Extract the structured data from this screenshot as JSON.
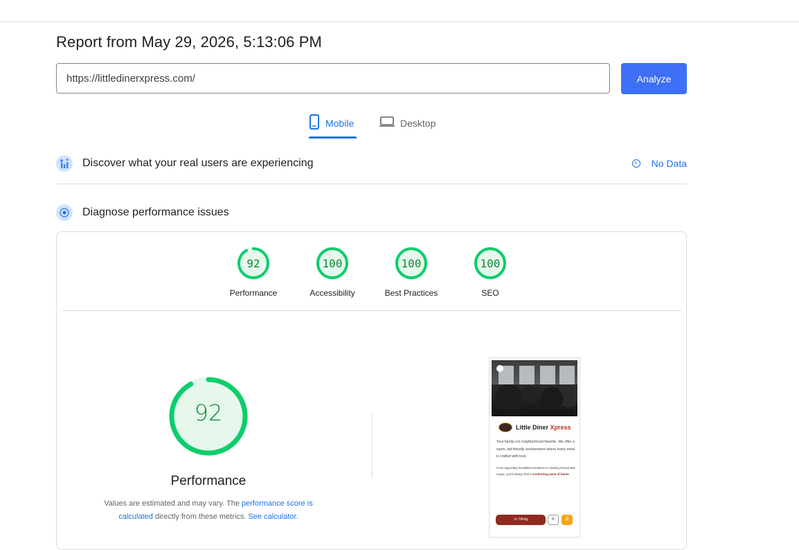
{
  "colors": {
    "primary": "#3e6ff4",
    "link": "#1a73e8",
    "score_good": "#0cce6b",
    "score_text": "#0a8a35",
    "divider": "#dadce0"
  },
  "report": {
    "title": "Report from May 29, 2026, 5:13:06 PM"
  },
  "url_input": {
    "value": "https://littledinerxpress.com/"
  },
  "analyze_button": {
    "label": "Analyze"
  },
  "tabs": [
    {
      "label": "Mobile",
      "icon": "smartphone-icon",
      "selected": true
    },
    {
      "label": "Desktop",
      "icon": "laptop-icon",
      "selected": false
    }
  ],
  "crux": {
    "title": "Discover what your real users are experiencing",
    "icon": "users-chart-icon",
    "status_label": "No Data",
    "status_icon": "info-icon"
  },
  "diagnose": {
    "title": "Diagnose performance issues",
    "icon": "target-icon"
  },
  "scores": [
    {
      "label": "Performance",
      "value": "92",
      "fraction": 0.92
    },
    {
      "label": "Accessibility",
      "value": "100",
      "fraction": 1.0
    },
    {
      "label": "Best Practices",
      "value": "100",
      "fraction": 1.0
    },
    {
      "label": "SEO",
      "value": "100",
      "fraction": 1.0
    }
  ],
  "performance_detail": {
    "value": "92",
    "fraction": 0.92,
    "label": "Performance",
    "desc_prefix": "Values are estimated and may vary. The ",
    "desc_link1": "performance score is calculated",
    "desc_middle": " directly from these metrics. ",
    "desc_link2": "See calculator."
  },
  "screenshot": {
    "brand_prefix": "Little Diner ",
    "brand_accent": "Xpress",
    "paragraph1": "Your family-run neighborhood favorite. We offer a warm, kid-friendly environment where every meal is crafted with love.",
    "paragraph2_prefix": "From legendary breakfast benedicts to rotating homemade soups, you'll always find a ",
    "paragraph2_bold": "comforting taste of home.",
    "cta_label": "☏ Hiring",
    "call_icon": "phone-icon",
    "menu_icon": "menu-icon"
  }
}
